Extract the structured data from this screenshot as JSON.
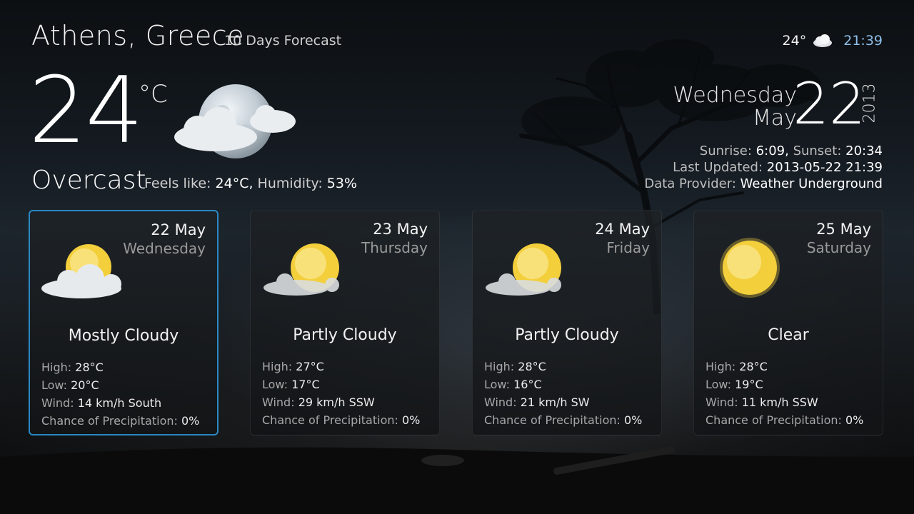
{
  "header": {
    "city": "Athens, Greece",
    "subtitle": "10 Days Forecast"
  },
  "top_right": {
    "temp": "24°",
    "icon": "cloud-icon",
    "time": "21:39"
  },
  "current": {
    "temp": "24",
    "unit": "°C",
    "icon": "moon-cloud-icon",
    "condition": "Overcast",
    "feels_label": "Feels like:",
    "feels_value": "24°C,",
    "humidity_label": "Humidity:",
    "humidity_value": "53%"
  },
  "date": {
    "weekday": "Wednesday",
    "month": "May",
    "day": "22",
    "year": "2013"
  },
  "info": {
    "sunrise_label": "Sunrise:",
    "sunrise_value": "6:09,",
    "sunset_label": "Sunset:",
    "sunset_value": "20:34",
    "updated_label": "Last Updated:",
    "updated_value": "2013-05-22 21:39",
    "provider_label": "Data Provider:",
    "provider_value": "Weather Underground"
  },
  "labels": {
    "high": "High:",
    "low": "Low:",
    "wind": "Wind:",
    "precip": "Chance of Precipitation:"
  },
  "forecast": [
    {
      "date": "22 May",
      "day": "Wednesday",
      "icon": "sun-cloud-icon",
      "condition": "Mostly Cloudy",
      "high": "28°C",
      "low": "20°C",
      "wind": "14 km/h South",
      "precip": "0%"
    },
    {
      "date": "23 May",
      "day": "Thursday",
      "icon": "sun-cloud-icon",
      "condition": "Partly Cloudy",
      "high": "27°C",
      "low": "17°C",
      "wind": "29 km/h SSW",
      "precip": "0%"
    },
    {
      "date": "24 May",
      "day": "Friday",
      "icon": "sun-cloud-icon",
      "condition": "Partly Cloudy",
      "high": "28°C",
      "low": "16°C",
      "wind": "21 km/h SW",
      "precip": "0%"
    },
    {
      "date": "25 May",
      "day": "Saturday",
      "icon": "sun-icon",
      "condition": "Clear",
      "high": "28°C",
      "low": "19°C",
      "wind": "11 km/h SSW",
      "precip": "0%"
    }
  ],
  "colors": {
    "accent": "#2a88c2",
    "time": "#8fbfe8",
    "sun": "#f6d23a"
  }
}
